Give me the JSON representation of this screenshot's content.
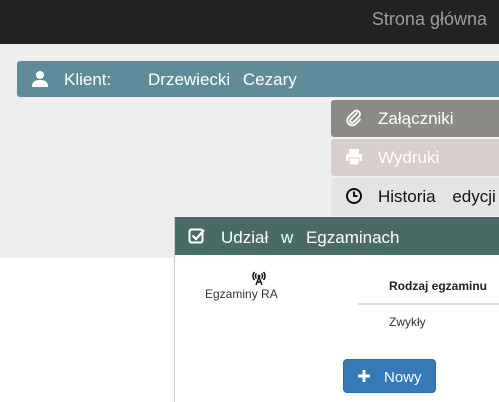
{
  "navbar": {
    "home_link": "Strona główna"
  },
  "client": {
    "label": "Klient:",
    "name": "Drzewiecki Cezary",
    "icon": "user-icon"
  },
  "side_actions": [
    {
      "label": "Załączniki",
      "icon": "paperclip-icon",
      "color": "#8c8a84"
    },
    {
      "label": "Wydruki",
      "icon": "print-icon",
      "color": "#d8cfcd"
    },
    {
      "label": "Historia edycji",
      "icon": "clock-icon",
      "color": "#e4e4e4"
    }
  ],
  "exams_panel": {
    "title": "Udział w Egzaminach",
    "icon": "checkbox-icon",
    "type_icon": "radio-tower-icon",
    "type_label": "Egzaminy RA",
    "table": {
      "headers": [
        "Rodzaj egzaminu"
      ],
      "rows": [
        [
          "Zwykły"
        ]
      ]
    },
    "new_button": "Nowy"
  },
  "colors": {
    "navbar": "#222222",
    "client_bar": "#5f8b9a",
    "panel_header": "#4a6a66",
    "primary_button": "#337ab7"
  }
}
